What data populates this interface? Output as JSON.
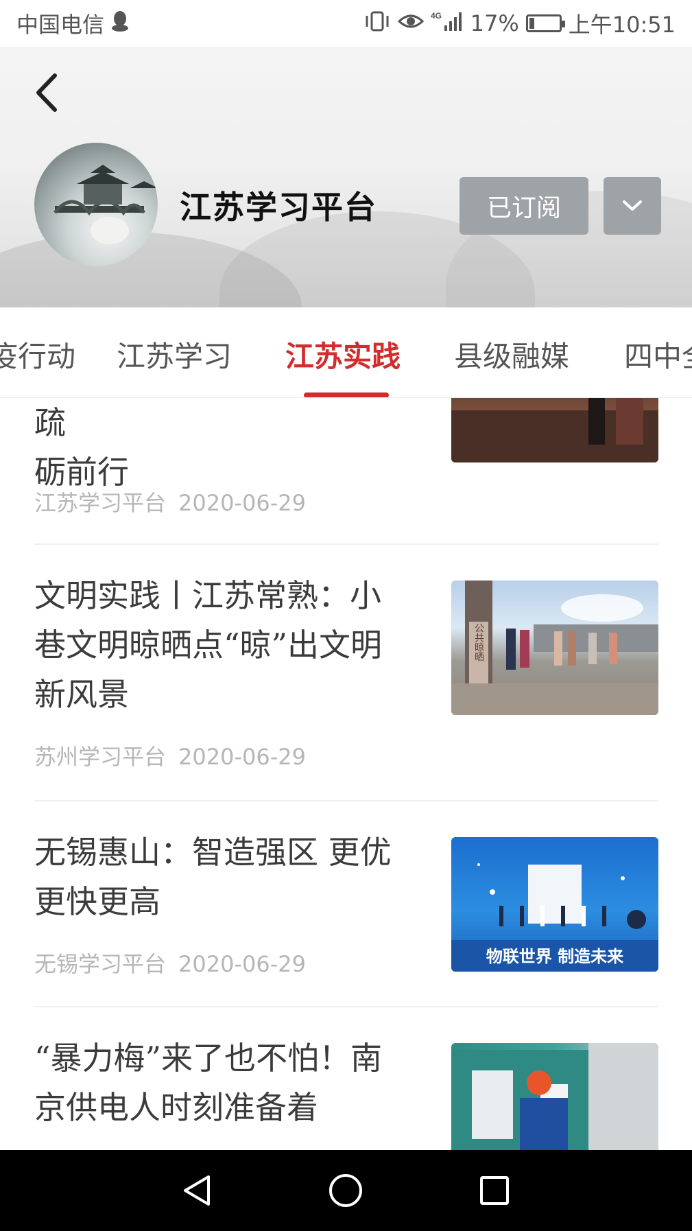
{
  "status_bar": {
    "carrier": "中国电信",
    "network": "4G",
    "battery_percent": "17%",
    "battery_level": 0.17,
    "time": "上午10:51"
  },
  "header": {
    "channel_name": "江苏学习平台",
    "subscribe_label": "已订阅"
  },
  "tabs": [
    {
      "label": "疫行动",
      "active": false
    },
    {
      "label": "江苏学习",
      "active": false
    },
    {
      "label": "江苏实践",
      "active": true
    },
    {
      "label": "县级融媒",
      "active": false
    },
    {
      "label": "四中全",
      "active": false
    }
  ],
  "articles": [
    {
      "title_lines": [
        "启 · 决 先 派 · 常 着 信 种 疏",
        "砺前行"
      ],
      "source": "江苏学习平台",
      "date": "2020-06-29"
    },
    {
      "title_lines": [
        "文明实践丨江苏常熟：小",
        "巷文明晾晒点“晾”出文明",
        "新风景"
      ],
      "source": "苏州学习平台",
      "date": "2020-06-29"
    },
    {
      "title_lines": [
        "无锡惠山：智造强区 更优",
        "更快更高"
      ],
      "source": "无锡学习平台",
      "date": "2020-06-29"
    },
    {
      "title_lines": [
        "“暴力梅”来了也不怕！南",
        "京供电人时刻准备着"
      ],
      "source": "",
      "date": ""
    }
  ],
  "thumb_texts": {
    "a2_sign": "公共晾晒",
    "a3_banner": "物联世界  制造未来"
  },
  "icons": {
    "back": "back-arrow-icon",
    "dropdown": "chevron-down-icon",
    "nav_back": "triangle-back-icon",
    "nav_home": "circle-home-icon",
    "nav_recent": "square-recents-icon"
  },
  "colors": {
    "accent": "#d22c2c",
    "button_gray": "#9ea3a8",
    "meta_gray": "#b6b6b6"
  }
}
